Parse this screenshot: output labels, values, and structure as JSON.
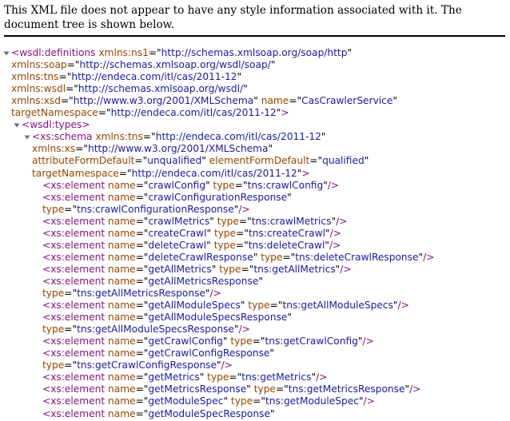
{
  "notice": "This XML file does not appear to have any style information associated with it. The document tree is shown below.",
  "colors": {
    "tag": "#881280",
    "attr": "#994500",
    "value": "#1a1aa6",
    "punct": "#000000"
  },
  "toggle_icon": "triangle-down-icon",
  "lines": [
    {
      "indent": 14,
      "toggle": true,
      "segs": [
        [
          "t",
          "<wsdl:definitions"
        ],
        [
          "p",
          " "
        ],
        [
          "a",
          "xmlns:ns1"
        ],
        [
          "e",
          "=\""
        ],
        [
          "v",
          "http://schemas.xmlsoap.org/soap/http"
        ],
        [
          "e",
          "\""
        ]
      ]
    },
    {
      "indent": 14,
      "segs": [
        [
          "a",
          "xmlns:soap"
        ],
        [
          "e",
          "=\""
        ],
        [
          "v",
          "http://schemas.xmlsoap.org/wsdl/soap/"
        ],
        [
          "e",
          "\""
        ]
      ]
    },
    {
      "indent": 14,
      "segs": [
        [
          "a",
          "xmlns:tns"
        ],
        [
          "e",
          "=\""
        ],
        [
          "v",
          "http://endeca.com/itl/cas/2011-12"
        ],
        [
          "e",
          "\""
        ]
      ]
    },
    {
      "indent": 14,
      "segs": [
        [
          "a",
          "xmlns:wsdl"
        ],
        [
          "e",
          "=\""
        ],
        [
          "v",
          "http://schemas.xmlsoap.org/wsdl/"
        ],
        [
          "e",
          "\""
        ]
      ]
    },
    {
      "indent": 14,
      "segs": [
        [
          "a",
          "xmlns:xsd"
        ],
        [
          "e",
          "=\""
        ],
        [
          "v",
          "http://www.w3.org/2001/XMLSchema"
        ],
        [
          "e",
          "\""
        ],
        [
          "p",
          " "
        ],
        [
          "a",
          "name"
        ],
        [
          "e",
          "=\""
        ],
        [
          "v",
          "CasCrawlerService"
        ],
        [
          "e",
          "\""
        ]
      ]
    },
    {
      "indent": 14,
      "segs": [
        [
          "a",
          "targetNamespace"
        ],
        [
          "e",
          "=\""
        ],
        [
          "v",
          "http://endeca.com/itl/cas/2011-12"
        ],
        [
          "e",
          "\""
        ],
        [
          "t",
          ">"
        ]
      ]
    },
    {
      "indent": 27,
      "toggle": true,
      "segs": [
        [
          "t",
          "<wsdl:types>"
        ]
      ]
    },
    {
      "indent": 40,
      "toggle": true,
      "segs": [
        [
          "t",
          "<xs:schema"
        ],
        [
          "p",
          " "
        ],
        [
          "a",
          "xmlns:tns"
        ],
        [
          "e",
          "=\""
        ],
        [
          "v",
          "http://endeca.com/itl/cas/2011-12"
        ],
        [
          "e",
          "\""
        ]
      ]
    },
    {
      "indent": 40,
      "segs": [
        [
          "a",
          "xmlns:xs"
        ],
        [
          "e",
          "=\""
        ],
        [
          "v",
          "http://www.w3.org/2001/XMLSchema"
        ],
        [
          "e",
          "\""
        ]
      ]
    },
    {
      "indent": 40,
      "segs": [
        [
          "a",
          "attributeFormDefault"
        ],
        [
          "e",
          "=\""
        ],
        [
          "v",
          "unqualified"
        ],
        [
          "e",
          "\""
        ],
        [
          "p",
          " "
        ],
        [
          "a",
          "elementFormDefault"
        ],
        [
          "e",
          "=\""
        ],
        [
          "v",
          "qualified"
        ],
        [
          "e",
          "\""
        ]
      ]
    },
    {
      "indent": 40,
      "segs": [
        [
          "a",
          "targetNamespace"
        ],
        [
          "e",
          "=\""
        ],
        [
          "v",
          "http://endeca.com/itl/cas/2011-12"
        ],
        [
          "e",
          "\""
        ],
        [
          "t",
          ">"
        ]
      ]
    },
    {
      "indent": 53,
      "segs": [
        [
          "t",
          "<xs:element"
        ],
        [
          "p",
          " "
        ],
        [
          "a",
          "name"
        ],
        [
          "e",
          "=\""
        ],
        [
          "v",
          "crawlConfig"
        ],
        [
          "e",
          "\""
        ],
        [
          "p",
          " "
        ],
        [
          "a",
          "type"
        ],
        [
          "e",
          "=\""
        ],
        [
          "v",
          "tns:crawlConfig"
        ],
        [
          "e",
          "\""
        ],
        [
          "t",
          "/>"
        ]
      ]
    },
    {
      "indent": 53,
      "segs": [
        [
          "t",
          "<xs:element"
        ],
        [
          "p",
          " "
        ],
        [
          "a",
          "name"
        ],
        [
          "e",
          "=\""
        ],
        [
          "v",
          "crawlConfigurationResponse"
        ],
        [
          "e",
          "\""
        ]
      ]
    },
    {
      "indent": 53,
      "segs": [
        [
          "a",
          "type"
        ],
        [
          "e",
          "=\""
        ],
        [
          "v",
          "tns:crawlConfigurationResponse"
        ],
        [
          "e",
          "\""
        ],
        [
          "t",
          "/>"
        ]
      ]
    },
    {
      "indent": 53,
      "segs": [
        [
          "t",
          "<xs:element"
        ],
        [
          "p",
          " "
        ],
        [
          "a",
          "name"
        ],
        [
          "e",
          "=\""
        ],
        [
          "v",
          "crawlMetrics"
        ],
        [
          "e",
          "\""
        ],
        [
          "p",
          " "
        ],
        [
          "a",
          "type"
        ],
        [
          "e",
          "=\""
        ],
        [
          "v",
          "tns:crawlMetrics"
        ],
        [
          "e",
          "\""
        ],
        [
          "t",
          "/>"
        ]
      ]
    },
    {
      "indent": 53,
      "segs": [
        [
          "t",
          "<xs:element"
        ],
        [
          "p",
          " "
        ],
        [
          "a",
          "name"
        ],
        [
          "e",
          "=\""
        ],
        [
          "v",
          "createCrawl"
        ],
        [
          "e",
          "\""
        ],
        [
          "p",
          " "
        ],
        [
          "a",
          "type"
        ],
        [
          "e",
          "=\""
        ],
        [
          "v",
          "tns:createCrawl"
        ],
        [
          "e",
          "\""
        ],
        [
          "t",
          "/>"
        ]
      ]
    },
    {
      "indent": 53,
      "segs": [
        [
          "t",
          "<xs:element"
        ],
        [
          "p",
          " "
        ],
        [
          "a",
          "name"
        ],
        [
          "e",
          "=\""
        ],
        [
          "v",
          "deleteCrawl"
        ],
        [
          "e",
          "\""
        ],
        [
          "p",
          " "
        ],
        [
          "a",
          "type"
        ],
        [
          "e",
          "=\""
        ],
        [
          "v",
          "tns:deleteCrawl"
        ],
        [
          "e",
          "\""
        ],
        [
          "t",
          "/>"
        ]
      ]
    },
    {
      "indent": 53,
      "segs": [
        [
          "t",
          "<xs:element"
        ],
        [
          "p",
          " "
        ],
        [
          "a",
          "name"
        ],
        [
          "e",
          "=\""
        ],
        [
          "v",
          "deleteCrawlResponse"
        ],
        [
          "e",
          "\""
        ],
        [
          "p",
          " "
        ],
        [
          "a",
          "type"
        ],
        [
          "e",
          "=\""
        ],
        [
          "v",
          "tns:deleteCrawlResponse"
        ],
        [
          "e",
          "\""
        ],
        [
          "t",
          "/>"
        ]
      ]
    },
    {
      "indent": 53,
      "segs": [
        [
          "t",
          "<xs:element"
        ],
        [
          "p",
          " "
        ],
        [
          "a",
          "name"
        ],
        [
          "e",
          "=\""
        ],
        [
          "v",
          "getAllMetrics"
        ],
        [
          "e",
          "\""
        ],
        [
          "p",
          " "
        ],
        [
          "a",
          "type"
        ],
        [
          "e",
          "=\""
        ],
        [
          "v",
          "tns:getAllMetrics"
        ],
        [
          "e",
          "\""
        ],
        [
          "t",
          "/>"
        ]
      ]
    },
    {
      "indent": 53,
      "segs": [
        [
          "t",
          "<xs:element"
        ],
        [
          "p",
          " "
        ],
        [
          "a",
          "name"
        ],
        [
          "e",
          "=\""
        ],
        [
          "v",
          "getAllMetricsResponse"
        ],
        [
          "e",
          "\""
        ]
      ]
    },
    {
      "indent": 53,
      "segs": [
        [
          "a",
          "type"
        ],
        [
          "e",
          "=\""
        ],
        [
          "v",
          "tns:getAllMetricsResponse"
        ],
        [
          "e",
          "\""
        ],
        [
          "t",
          "/>"
        ]
      ]
    },
    {
      "indent": 53,
      "segs": [
        [
          "t",
          "<xs:element"
        ],
        [
          "p",
          " "
        ],
        [
          "a",
          "name"
        ],
        [
          "e",
          "=\""
        ],
        [
          "v",
          "getAllModuleSpecs"
        ],
        [
          "e",
          "\""
        ],
        [
          "p",
          " "
        ],
        [
          "a",
          "type"
        ],
        [
          "e",
          "=\""
        ],
        [
          "v",
          "tns:getAllModuleSpecs"
        ],
        [
          "e",
          "\""
        ],
        [
          "t",
          "/>"
        ]
      ]
    },
    {
      "indent": 53,
      "segs": [
        [
          "t",
          "<xs:element"
        ],
        [
          "p",
          " "
        ],
        [
          "a",
          "name"
        ],
        [
          "e",
          "=\""
        ],
        [
          "v",
          "getAllModuleSpecsResponse"
        ],
        [
          "e",
          "\""
        ]
      ]
    },
    {
      "indent": 53,
      "segs": [
        [
          "a",
          "type"
        ],
        [
          "e",
          "=\""
        ],
        [
          "v",
          "tns:getAllModuleSpecsResponse"
        ],
        [
          "e",
          "\""
        ],
        [
          "t",
          "/>"
        ]
      ]
    },
    {
      "indent": 53,
      "segs": [
        [
          "t",
          "<xs:element"
        ],
        [
          "p",
          " "
        ],
        [
          "a",
          "name"
        ],
        [
          "e",
          "=\""
        ],
        [
          "v",
          "getCrawlConfig"
        ],
        [
          "e",
          "\""
        ],
        [
          "p",
          " "
        ],
        [
          "a",
          "type"
        ],
        [
          "e",
          "=\""
        ],
        [
          "v",
          "tns:getCrawlConfig"
        ],
        [
          "e",
          "\""
        ],
        [
          "t",
          "/>"
        ]
      ]
    },
    {
      "indent": 53,
      "segs": [
        [
          "t",
          "<xs:element"
        ],
        [
          "p",
          " "
        ],
        [
          "a",
          "name"
        ],
        [
          "e",
          "=\""
        ],
        [
          "v",
          "getCrawlConfigResponse"
        ],
        [
          "e",
          "\""
        ]
      ]
    },
    {
      "indent": 53,
      "segs": [
        [
          "a",
          "type"
        ],
        [
          "e",
          "=\""
        ],
        [
          "v",
          "tns:getCrawlConfigResponse"
        ],
        [
          "e",
          "\""
        ],
        [
          "t",
          "/>"
        ]
      ]
    },
    {
      "indent": 53,
      "segs": [
        [
          "t",
          "<xs:element"
        ],
        [
          "p",
          " "
        ],
        [
          "a",
          "name"
        ],
        [
          "e",
          "=\""
        ],
        [
          "v",
          "getMetrics"
        ],
        [
          "e",
          "\""
        ],
        [
          "p",
          " "
        ],
        [
          "a",
          "type"
        ],
        [
          "e",
          "=\""
        ],
        [
          "v",
          "tns:getMetrics"
        ],
        [
          "e",
          "\""
        ],
        [
          "t",
          "/>"
        ]
      ]
    },
    {
      "indent": 53,
      "segs": [
        [
          "t",
          "<xs:element"
        ],
        [
          "p",
          " "
        ],
        [
          "a",
          "name"
        ],
        [
          "e",
          "=\""
        ],
        [
          "v",
          "getMetricsResponse"
        ],
        [
          "e",
          "\""
        ],
        [
          "p",
          " "
        ],
        [
          "a",
          "type"
        ],
        [
          "e",
          "=\""
        ],
        [
          "v",
          "tns:getMetricsResponse"
        ],
        [
          "e",
          "\""
        ],
        [
          "t",
          "/>"
        ]
      ]
    },
    {
      "indent": 53,
      "segs": [
        [
          "t",
          "<xs:element"
        ],
        [
          "p",
          " "
        ],
        [
          "a",
          "name"
        ],
        [
          "e",
          "=\""
        ],
        [
          "v",
          "getModuleSpec"
        ],
        [
          "e",
          "\""
        ],
        [
          "p",
          " "
        ],
        [
          "a",
          "type"
        ],
        [
          "e",
          "=\""
        ],
        [
          "v",
          "tns:getModuleSpec"
        ],
        [
          "e",
          "\""
        ],
        [
          "t",
          "/>"
        ]
      ]
    },
    {
      "indent": 53,
      "segs": [
        [
          "t",
          "<xs:element"
        ],
        [
          "p",
          " "
        ],
        [
          "a",
          "name"
        ],
        [
          "e",
          "=\""
        ],
        [
          "v",
          "getModuleSpecResponse"
        ],
        [
          "e",
          "\""
        ]
      ]
    }
  ]
}
